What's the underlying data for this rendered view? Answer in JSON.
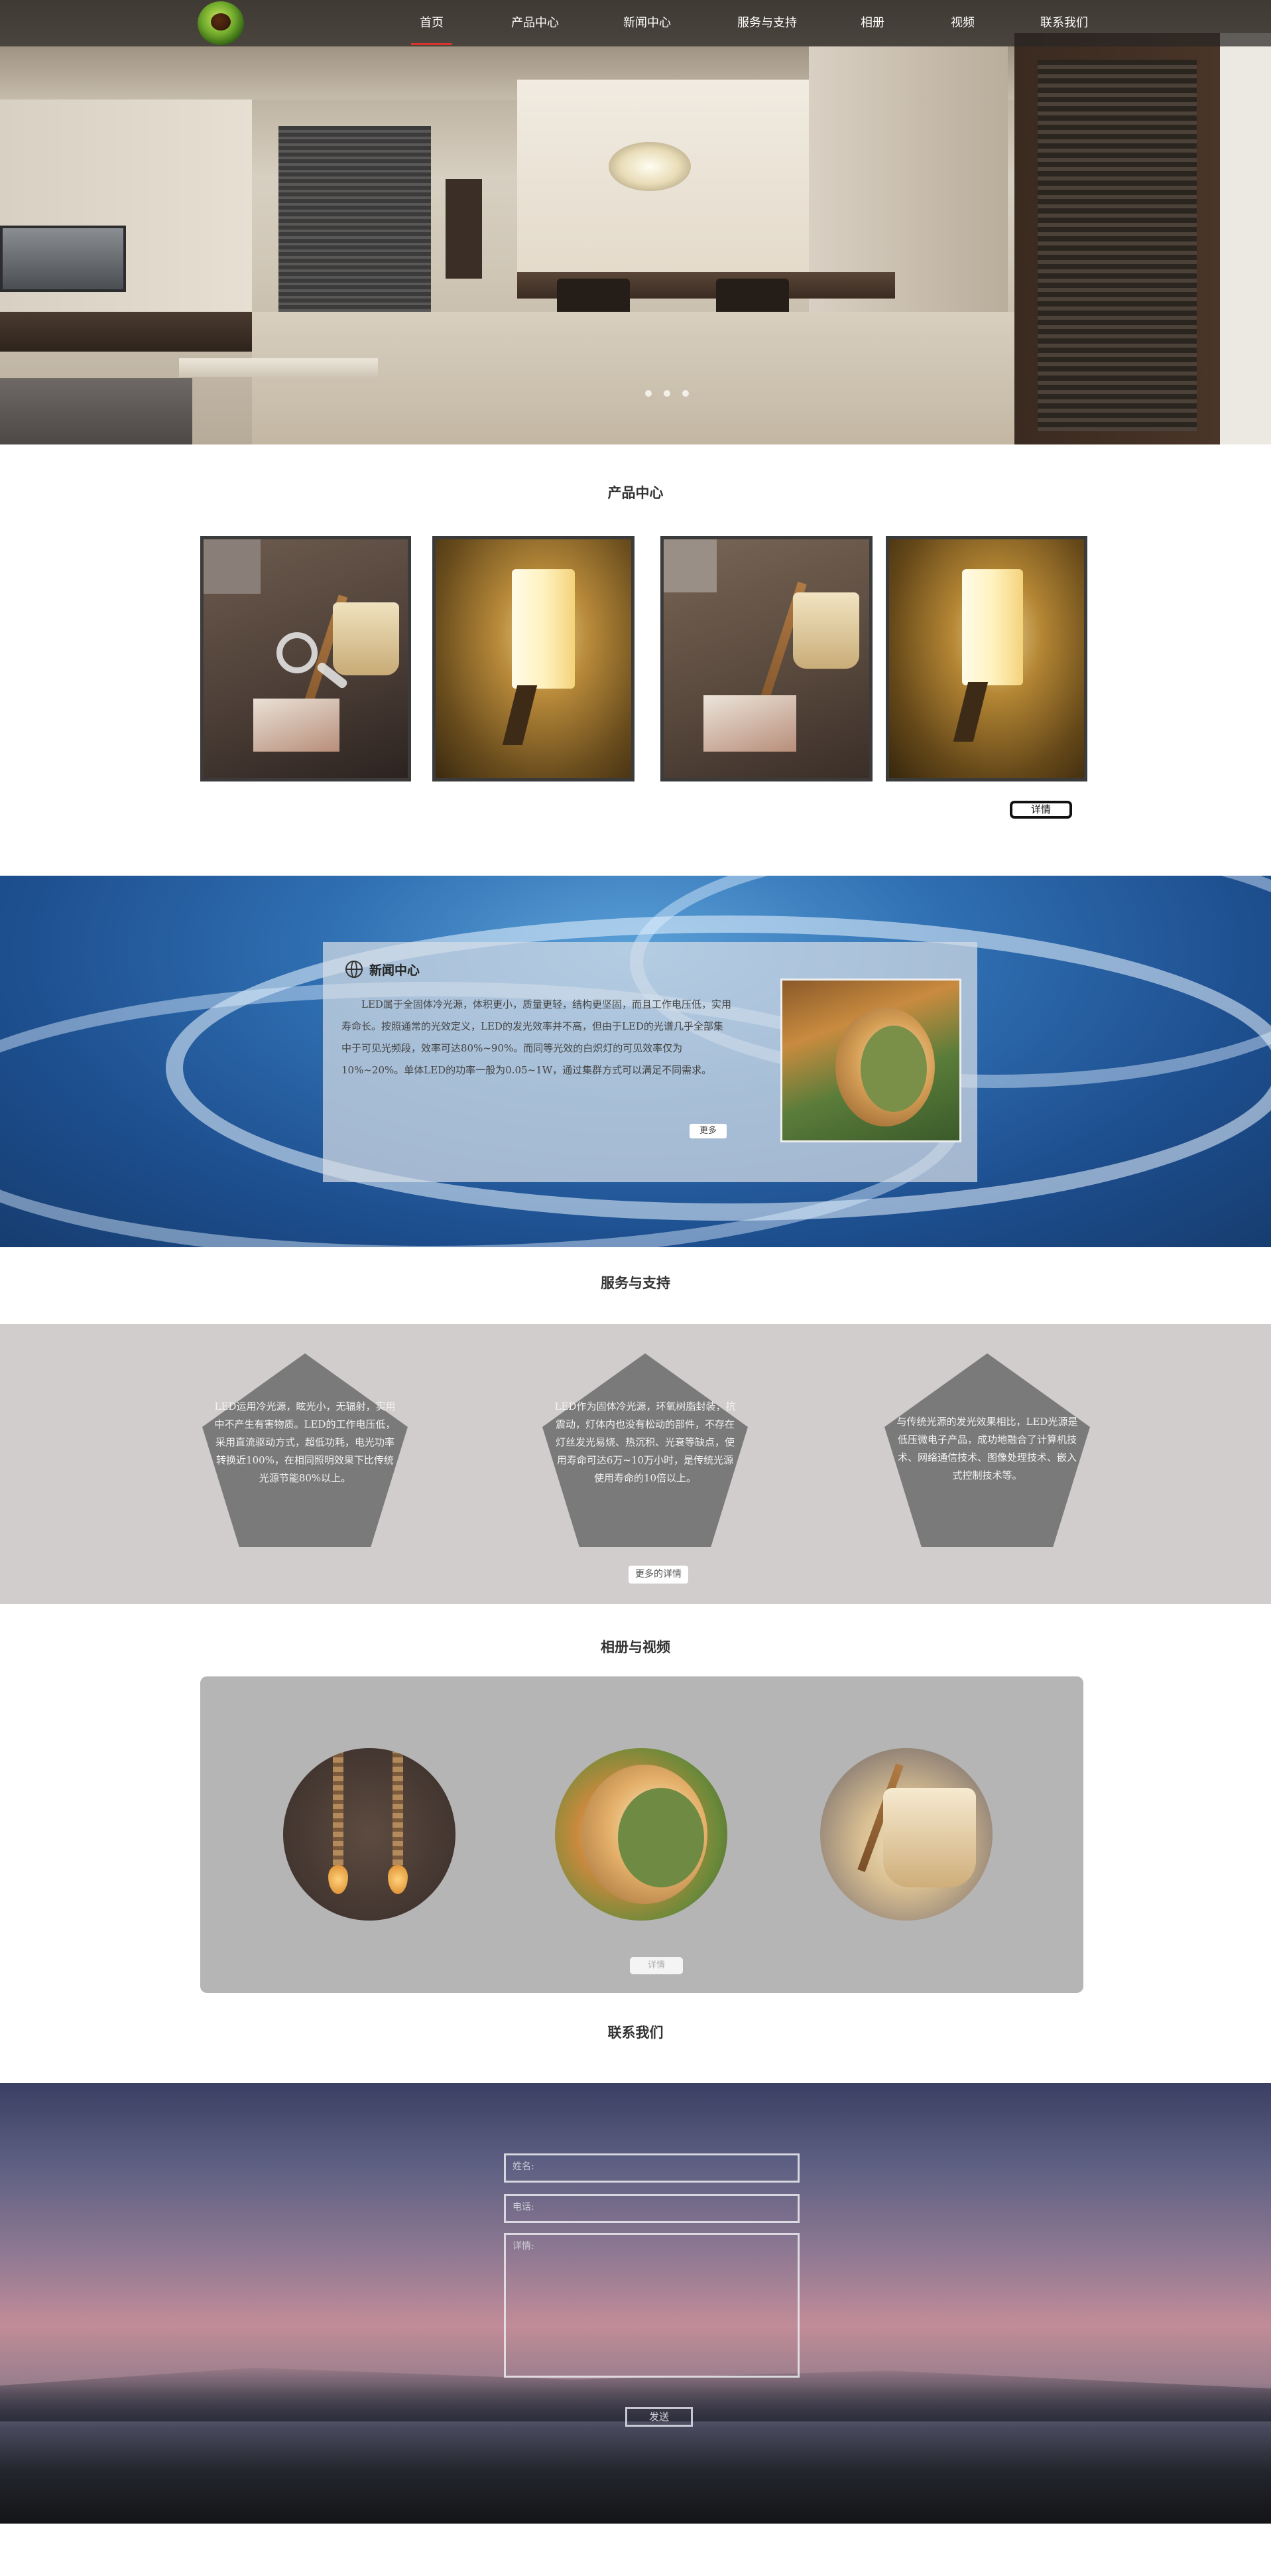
{
  "nav": {
    "logo_icon": "leaf-logo-icon",
    "items": [
      "首页",
      "产品中心",
      "新闻中心",
      "服务与支持",
      "相册",
      "视频",
      "联系我们"
    ],
    "active_index": 0,
    "active_color": "#d9332b"
  },
  "hero": {
    "slide_count": 3
  },
  "products": {
    "title": "产品中心",
    "items": [
      {
        "icon": "table-lamp-with-magnifier-icon"
      },
      {
        "icon": "wall-lamp-icon"
      },
      {
        "icon": "table-lamp-icon"
      },
      {
        "icon": "wall-lamp-icon"
      }
    ],
    "detail_label": "详情"
  },
  "news": {
    "title_icon": "globe-icon",
    "title": "新闻中心",
    "text": "LED属于全固体冷光源，体积更小，质量更轻，结构更坚固，而且工作电压低，实用寿命长。按照通常的光效定义，LED的发光效率并不高，但由于LED的光谱几乎全部集中于可见光频段，效率可达80%~90%。而同等光效的白炽灯的可见效率仅为10%~20%。单体LED的功率一般为0.05~1W，通过集群方式可以满足不同需求。",
    "more_label": "更多"
  },
  "service": {
    "title": "服务与支持",
    "items": [
      "LED运用冷光源，眩光小，无辐射，实用中不产生有害物质。LED的工作电压低，采用直流驱动方式，超低功耗，电光功率转换近100%，在相同照明效果下比传统光源节能80%以上。",
      "LED作为固体冷光源，环氧树脂封装，抗震动，灯体内也没有松动的部件，不存在灯丝发光易烧、热沉积、光衰等缺点，使用寿命可达6万~10万小时，是传统光源使用寿命的10倍以上。",
      "与传统光源的发光效果相比，LED光源是低压微电子产品，成功地融合了计算机技术、网络通信技术、图像处理技术、嵌入式控制技术等。"
    ],
    "more_label": "更多的详情"
  },
  "album": {
    "title": "相册与视频",
    "items": [
      {
        "icon": "rope-pendant-bulbs-icon"
      },
      {
        "icon": "moon-lamp-icon"
      },
      {
        "icon": "table-lamp-icon"
      }
    ],
    "detail_label": "详情"
  },
  "contact": {
    "title": "联系我们",
    "name_placeholder": "姓名:",
    "phone_placeholder": "电话:",
    "detail_placeholder": "详情:",
    "send_label": "发送"
  }
}
